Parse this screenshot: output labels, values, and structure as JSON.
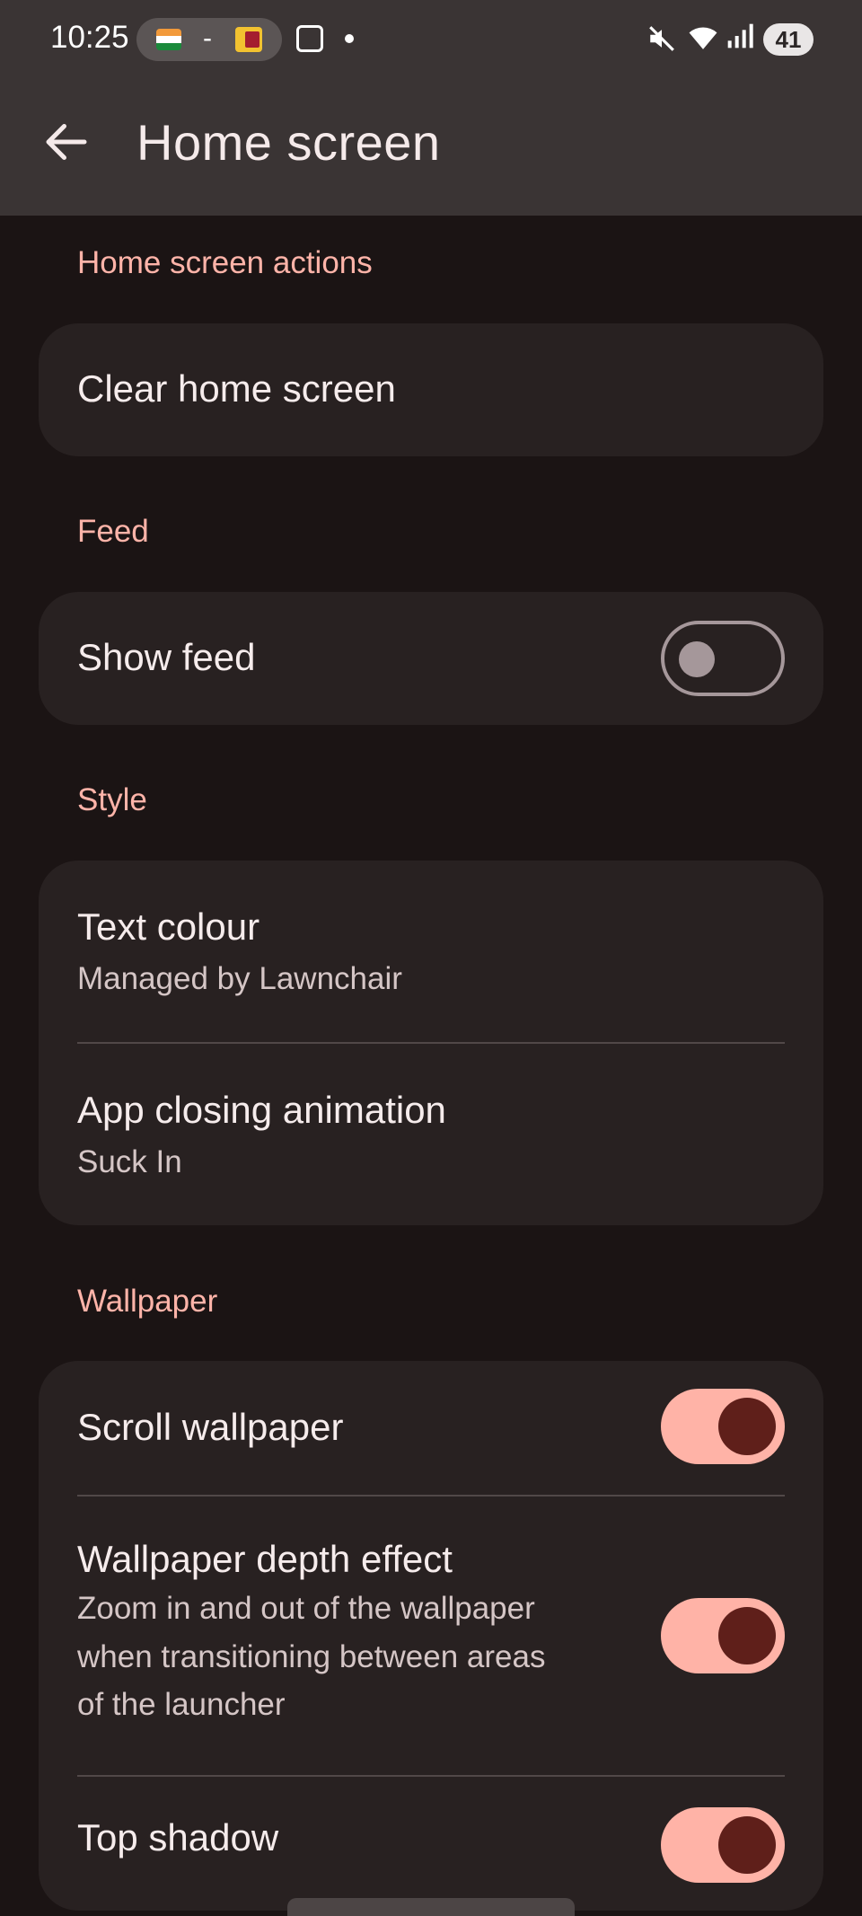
{
  "status_bar": {
    "time": "10:25",
    "separator": "-",
    "battery": "41",
    "icons": [
      "india-flag-icon",
      "sri-lanka-flag-icon",
      "screenshot-icon",
      "notification-dot-icon",
      "mute-icon",
      "wifi-icon",
      "signal-icon",
      "battery-icon"
    ]
  },
  "app_bar": {
    "title": "Home screen",
    "back_icon": "arrow-left-icon"
  },
  "sections": {
    "actions": {
      "header": "Home screen actions",
      "clear": "Clear home screen"
    },
    "feed": {
      "header": "Feed",
      "show_feed": {
        "title": "Show feed",
        "enabled": false
      }
    },
    "style": {
      "header": "Style",
      "text_colour": {
        "title": "Text colour",
        "value": "Managed by Lawnchair"
      },
      "closing_anim": {
        "title": "App closing animation",
        "value": "Suck In"
      }
    },
    "wallpaper": {
      "header": "Wallpaper",
      "scroll": {
        "title": "Scroll wallpaper",
        "enabled": true
      },
      "depth": {
        "title": "Wallpaper depth effect",
        "desc_line1": "Zoom in and out of the wallpaper",
        "desc_line2": "when transitioning between areas",
        "desc_line3": "of the launcher",
        "enabled": true
      },
      "top_shadow": {
        "title": "Top shadow",
        "enabled": true
      }
    }
  },
  "colors": {
    "accent": "#ffb4a9",
    "background": "#1b1414",
    "card": "#282121",
    "switch_on_track": "#ffb3a7",
    "switch_on_thumb": "#5f1f1a"
  }
}
